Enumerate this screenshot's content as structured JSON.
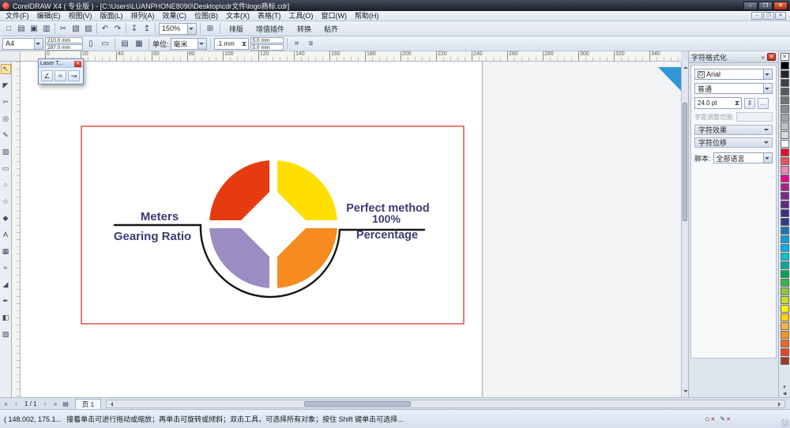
{
  "titlebar": {
    "title": "CorelDRAW X4 ( 专业版 ) - [C:\\Users\\LUANPHONE8090\\Desktop\\cdr文件\\logo商标.cdr]",
    "minimize": "–",
    "maximize": "❐",
    "close": "✕"
  },
  "menubar": {
    "items": [
      "文件(F)",
      "编辑(E)",
      "视图(V)",
      "版面(L)",
      "排列(A)",
      "效果(C)",
      "位图(B)",
      "文本(X)",
      "表格(T)",
      "工具(O)",
      "窗口(W)",
      "帮助(H)"
    ],
    "doc_minimize": "–",
    "doc_restore": "❐",
    "doc_close": "✕"
  },
  "toolbar": {
    "icons": [
      {
        "name": "new-document-icon",
        "glyph": "□"
      },
      {
        "name": "open-icon",
        "glyph": "▤"
      },
      {
        "name": "save-icon",
        "glyph": "▣"
      },
      {
        "name": "print-icon",
        "glyph": "▥"
      },
      {
        "sep": true
      },
      {
        "name": "cut-icon",
        "glyph": "✂"
      },
      {
        "name": "copy-icon",
        "glyph": "▧"
      },
      {
        "name": "paste-icon",
        "glyph": "▨"
      },
      {
        "sep": true
      },
      {
        "name": "undo-icon",
        "glyph": "↶"
      },
      {
        "name": "redo-icon",
        "glyph": "↷"
      },
      {
        "sep": true
      },
      {
        "name": "import-icon",
        "glyph": "↧"
      },
      {
        "name": "export-icon",
        "glyph": "↥"
      },
      {
        "sep": true
      }
    ],
    "zoom_value": "150%",
    "launcher_icon": "⊞",
    "text_buttons": [
      "排版",
      "增值插件",
      "转换",
      "粘齐"
    ]
  },
  "property_bar": {
    "paper_size": "A4",
    "page_width": "210.0 mm",
    "page_height": "297.0 mm",
    "portrait_icon": "▯",
    "landscape_icon": "▭",
    "all_pages_icon": "▤",
    "current_page_icon": "▦",
    "units_label": "单位:",
    "units_value": "毫米",
    "nudge_value": ".1 mm",
    "dup_x": "5.0 mm",
    "dup_y": "5.0 mm",
    "snap_icon": "⌗",
    "options_icon": "≡"
  },
  "ruler": {
    "h_labels": [
      "0",
      "20",
      "40",
      "60",
      "80",
      "100",
      "120",
      "140",
      "160",
      "180",
      "200",
      "220",
      "240",
      "260",
      "280",
      "300",
      "320",
      "340"
    ]
  },
  "toolbox": [
    {
      "name": "pick-tool-icon",
      "glyph": "↖",
      "active": true
    },
    {
      "name": "shape-tool-icon",
      "glyph": "◤"
    },
    {
      "name": "crop-tool-icon",
      "glyph": "✂"
    },
    {
      "name": "zoom-tool-icon",
      "glyph": "◎"
    },
    {
      "name": "freehand-tool-icon",
      "glyph": "✎"
    },
    {
      "name": "smart-fill-tool-icon",
      "glyph": "▨"
    },
    {
      "name": "rectangle-tool-icon",
      "glyph": "▭"
    },
    {
      "name": "ellipse-tool-icon",
      "glyph": "○"
    },
    {
      "name": "polygon-tool-icon",
      "glyph": "☆"
    },
    {
      "name": "basic-shapes-tool-icon",
      "glyph": "◆"
    },
    {
      "name": "text-tool-icon",
      "glyph": "A"
    },
    {
      "name": "table-tool-icon",
      "glyph": "▦"
    },
    {
      "name": "interactive-tool-icon",
      "glyph": "≈"
    },
    {
      "name": "eyedropper-tool-icon",
      "glyph": "◢"
    },
    {
      "name": "outline-tool-icon",
      "glyph": "✒"
    },
    {
      "name": "fill-tool-icon",
      "glyph": "◧"
    },
    {
      "name": "interactive-fill-tool-icon",
      "glyph": "▧"
    }
  ],
  "floating_palette": {
    "title": "Laser T...",
    "close": "✕",
    "buttons": [
      {
        "name": "laser-tool-1-icon",
        "glyph": "∠"
      },
      {
        "name": "laser-tool-2-icon",
        "glyph": "≈"
      },
      {
        "name": "laser-tool-3-icon",
        "glyph": "↝"
      }
    ]
  },
  "docker": {
    "title": "字符格式化",
    "menu_icon": "»",
    "font_badge": "O",
    "font_name": "Arial",
    "font_style": "普通",
    "font_size": "24.0 pt",
    "kerning_label": "字距调整范围:",
    "section_effects": "字符效果",
    "section_shift": "字符位移",
    "script_label": "脚本:",
    "script_value": "全部语言"
  },
  "palette": {
    "no_color": "✕",
    "colors": [
      "#000000",
      "#262626",
      "#404040",
      "#595959",
      "#737373",
      "#8c8c8c",
      "#a6a6a6",
      "#bfbfbf",
      "#d9d9d9",
      "#ffffff",
      "#e8112d",
      "#f05060",
      "#f287b7",
      "#ec008c",
      "#b01c87",
      "#7d2b8b",
      "#5f2a84",
      "#3f2b89",
      "#2b3990",
      "#1b75bb",
      "#0f9ed8",
      "#00aeef",
      "#00c5cd",
      "#00a99d",
      "#00a651",
      "#39b54a",
      "#8dc63f",
      "#c5d92d",
      "#fff200",
      "#ffd400",
      "#fbaf3f",
      "#f7941d",
      "#f26522",
      "#ef4123",
      "#9e3a26"
    ],
    "down_icon": "▼",
    "flyout_icon": "◀"
  },
  "artwork": {
    "frame_color": "#cc2a1e",
    "line_color": "#141414",
    "text_color": "#3c3b74",
    "corner_color": "#2f97d8",
    "colors": {
      "top_left": "#e63b11",
      "top_right": "#ffdf00",
      "bottom_right": "#f68b1f",
      "bottom_left": "#9b8cc3"
    },
    "labels": {
      "meters": "Meters",
      "gearing_ratio": "Gearing Ratio",
      "perfect_method": "Perfect method",
      "percent": "100%",
      "percentage": "Percentage"
    }
  },
  "pagebar": {
    "first_icon": "«",
    "prev_icon": "‹",
    "indicator": "1 / 1",
    "next_icon": "›",
    "last_icon": "»",
    "add_icon": "▤",
    "tab": "页 1"
  },
  "statusbar": {
    "coords": "( 148.002, 175.1...",
    "hint": "接着单击可进行拖动或缩放；再单击可旋转或倾斜；双击工具，可选择所有对象；按住 Shift 键单击可选择...",
    "fill_icon": "◇",
    "fill_state": "✕",
    "outline_icon": "✎",
    "outline_state": "✕"
  }
}
